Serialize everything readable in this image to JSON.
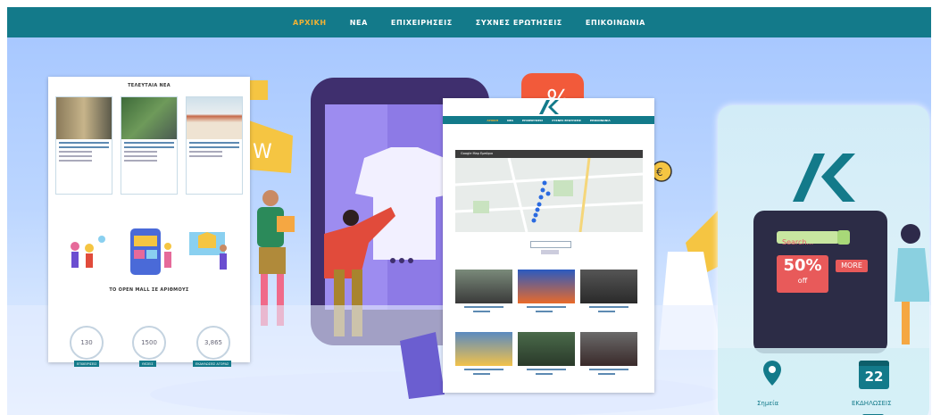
{
  "nav": {
    "items": [
      "ΑΡΧΙΚΗ",
      "ΝΕΑ",
      "ΕΠΙΧΕΙΡΗΣΕΙΣ",
      "ΣΥΧΝΕΣ ΕΡΩΤΗΣΕΙΣ",
      "ΕΠΙΚΟΙΝΩΝΙΑ"
    ],
    "active_index": 0
  },
  "left_screenshot": {
    "news_title": "ΤΕΛΕΥΤΑΙΑ ΝΕΑ",
    "section_title": "ΤΟ OPEN MALL ΣΕ ΑΡΙΘΜΟΥΣ",
    "stats": [
      {
        "value": "130",
        "label": "ΕΠΙΧΕΙΡΙΣΕΙΣ"
      },
      {
        "value": "1500",
        "label": "ΘΕΣΕΙΣ"
      },
      {
        "value": "3,865",
        "label": "ΕΚΔΗΛΩΣΕΙΣ ΑΓΟΡΑΣ"
      }
    ]
  },
  "center_screenshot": {
    "map_caption": "Google Map Εμπόριο"
  },
  "right_phone": {
    "search_placeholder": "Search...",
    "sale_percent": "50%",
    "sale_word": "off",
    "more_label": "MORE",
    "calendar_day": "22",
    "points_label": "Σημεία",
    "events_label": "ΕΚΔΗΛΩΣΕΙΣ"
  },
  "colors": {
    "nav_bg": "#137a8a",
    "nav_active": "#f2b233",
    "teal": "#137a8a"
  }
}
